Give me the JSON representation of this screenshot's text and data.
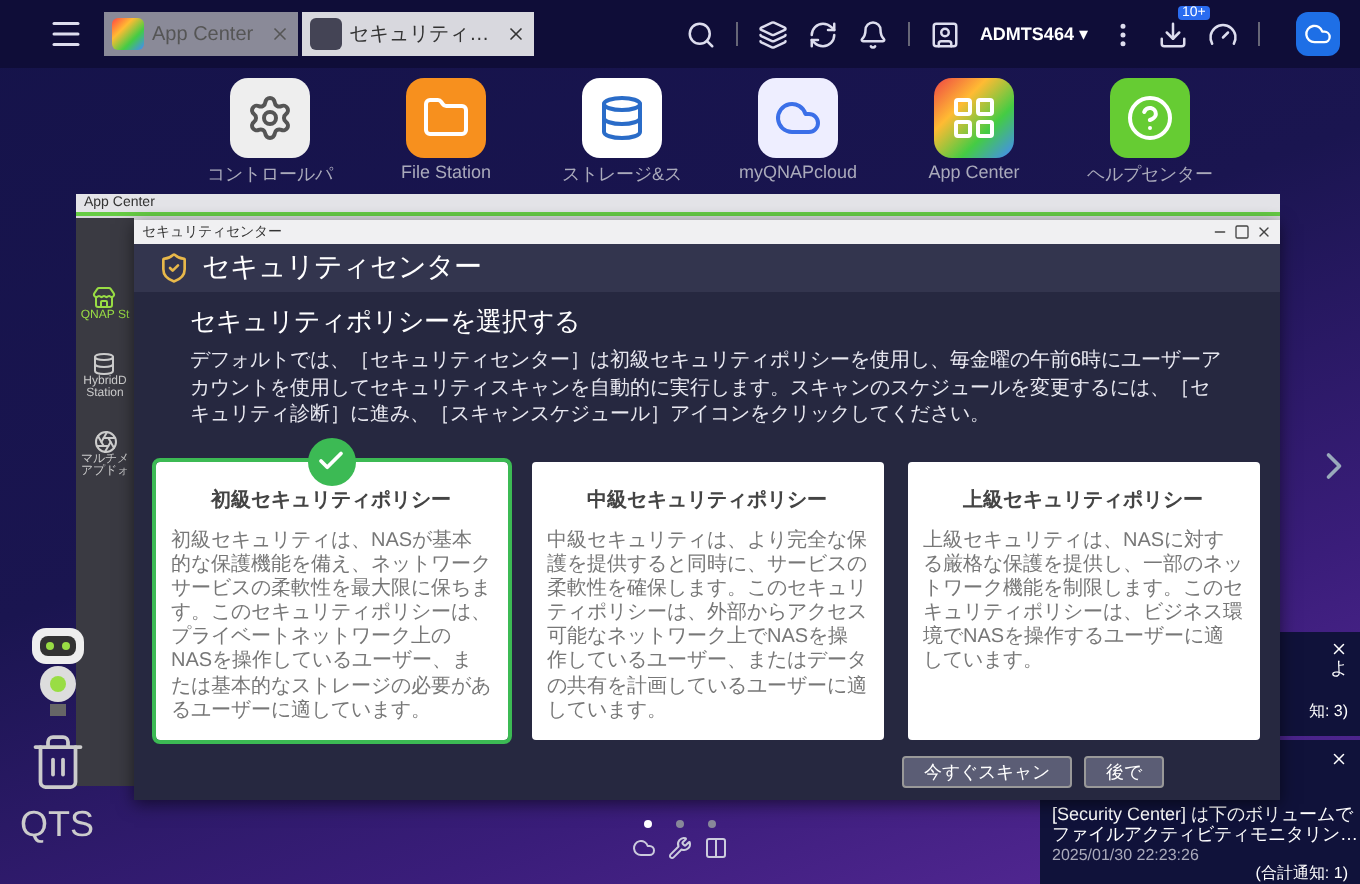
{
  "taskbar": {
    "tabs": [
      {
        "label": "App Center",
        "kind": "appcenter",
        "selected": false
      },
      {
        "label": "セキュリティ…",
        "kind": "security",
        "selected": true
      }
    ],
    "user": "ADMTS464",
    "user_caret": "▾",
    "badge": "10+"
  },
  "desktop_icons": [
    {
      "label": "コントロールパ",
      "kind": "settings"
    },
    {
      "label": "File Station",
      "kind": "files"
    },
    {
      "label": "ストレージ&ス",
      "kind": "storage"
    },
    {
      "label": "myQNAPcloud",
      "kind": "cloud"
    },
    {
      "label": "App Center",
      "kind": "apps"
    },
    {
      "label": "ヘルプセンター",
      "kind": "help"
    }
  ],
  "app_center": {
    "title": "App Center",
    "sidebar": [
      {
        "label": "QNAP St",
        "kind": "store",
        "selected": true
      },
      {
        "label": "HybridD",
        "sublabel": "Station",
        "kind": "hd",
        "selected": false
      },
      {
        "label": "マルチメ",
        "sublabel": "アプドォ",
        "kind": "media",
        "selected": false
      }
    ]
  },
  "security_center": {
    "window_title": "セキュリティセンター",
    "header": "セキュリティセンター",
    "heading": "セキュリティポリシーを選択する",
    "description": "デフォルトでは、［セキュリティセンター］は初級セキュリティポリシーを使用し、毎金曜の午前6時にユーザーアカウントを使用してセキュリティスキャンを自動的に実行します。スキャンのスケジュールを変更するには、［セキュリティ診断］に進み、［スキャンスケジュール］アイコンをクリックしてください。",
    "policies": [
      {
        "title": "初級セキュリティポリシー",
        "body": "初級セキュリティは、NASが基本的な保護機能を備え、ネットワークサービスの柔軟性を最大限に保ちます。このセキュリティポリシーは、プライベートネットワーク上のNASを操作しているユーザー、または基本的なストレージの必要があるユーザーに適しています。",
        "selected": true
      },
      {
        "title": "中級セキュリティポリシー",
        "body": "中級セキュリティは、より完全な保護を提供すると同時に、サービスの柔軟性を確保します。このセキュリティポリシーは、外部からアクセス可能なネットワーク上でNASを操作しているユーザー、またはデータの共有を計画しているユーザーに適しています。",
        "selected": false
      },
      {
        "title": "上級セキュリティポリシー",
        "body": "上級セキュリティは、NASに対する厳格な保護を提供し、一部のネットワーク機能を制限します。このセキュリティポリシーは、ビジネス環境でNASを操作するユーザーに適しています。",
        "selected": false
      }
    ],
    "buttons": [
      "今すぐスキャン",
      "後で"
    ]
  },
  "notifications": [
    {
      "lines": [
        "よ"
      ],
      "count": "知: 3)"
    },
    {
      "lines": [
        "[Security Center] は下のボリュームで",
        "ファイルアクティビティモニタリン…"
      ],
      "date": "2025/01/30 22:23:26",
      "count": "(合計通知: 1)"
    }
  ],
  "pager": [
    {
      "selected": true
    },
    {
      "selected": false
    },
    {
      "selected": false
    }
  ],
  "brand": "QTS"
}
